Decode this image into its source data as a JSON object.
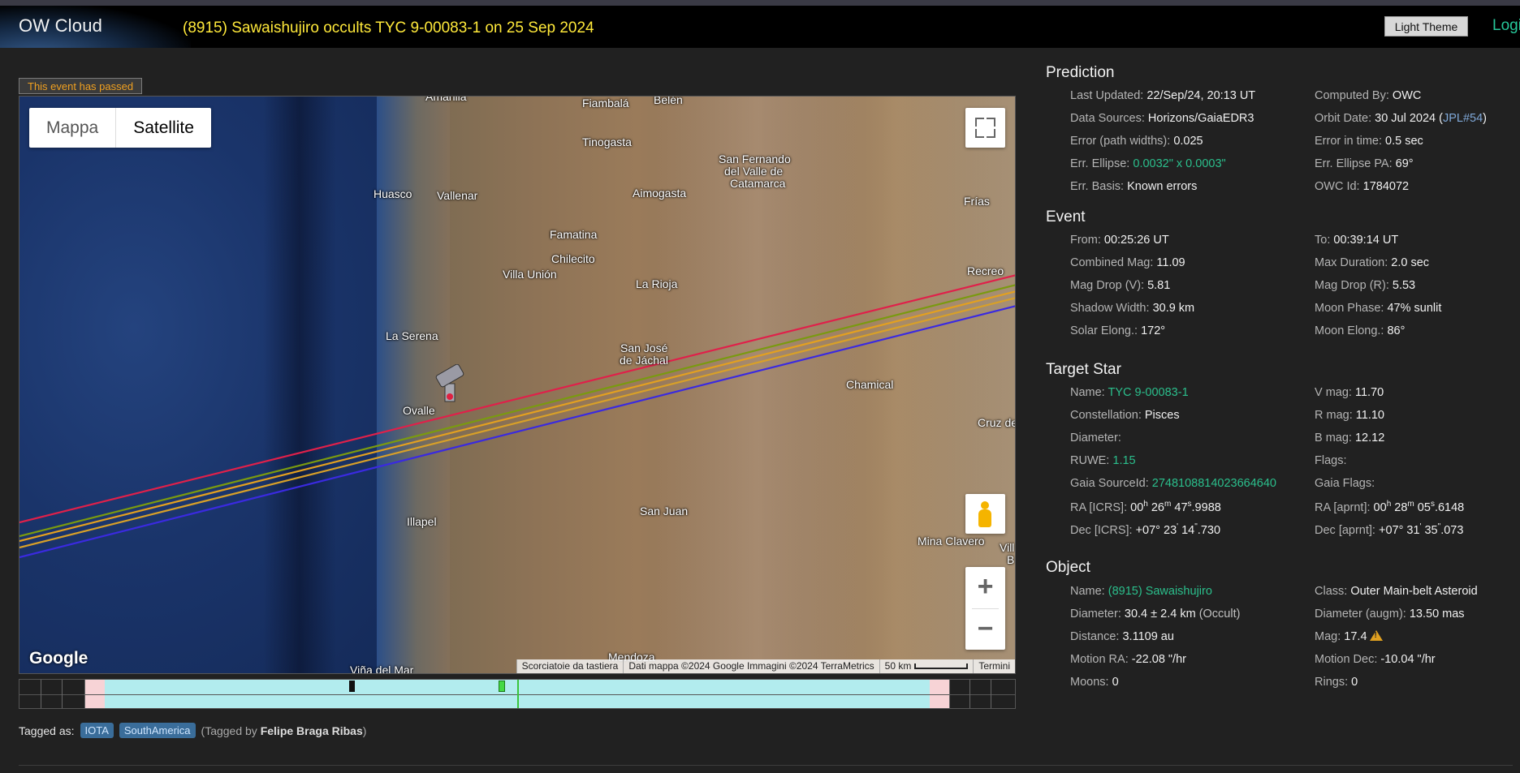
{
  "header": {
    "logo": "OW Cloud",
    "title": "(8915) Sawaishujiro occults TYC 9-00083-1 on 25 Sep 2024",
    "theme_button": "Light Theme",
    "login": "Logi"
  },
  "status_badge": "This event has passed",
  "map": {
    "maptype": [
      "Mappa",
      "Satellite"
    ],
    "places": [
      "Amarilla",
      "Fiambalá",
      "Belén",
      "Tinogasta",
      "San Fernando",
      "del Valle de",
      "Catamarca",
      "Huasco",
      "Vallenar",
      "Aimogasta",
      "Frías",
      "Famatina",
      "Chilecito",
      "Villa Unión",
      "La Rioja",
      "Recreo",
      "La Serena",
      "San José",
      "de Jáchal",
      "Chamical",
      "Ovalle",
      "Cruz de",
      "Illapel",
      "San Juan",
      "Mina Clavero",
      "Vill",
      "B",
      "Mendoza",
      "Viña del Mar"
    ],
    "google": "Google",
    "attribution": {
      "shortcuts": "Scorciatoie da tastiera",
      "data": "Dati mappa ©2024 Google Immagini ©2024 TerraMetrics",
      "scale": "50 km",
      "terms": "Termini"
    },
    "path_colors": [
      "#e0204a",
      "#7a9a10",
      "#e3a020",
      "#d8a028",
      "#3a2ae0"
    ]
  },
  "tags": {
    "label": "Tagged as:",
    "items": [
      "IOTA",
      "SouthAmerica"
    ],
    "tagged_by_prefix": "(Tagged by ",
    "tagged_by_name": "Felipe Braga Ribas",
    "tagged_by_suffix": ")"
  },
  "prediction": {
    "title": "Prediction",
    "last_updated_label": "Last Updated:",
    "last_updated": "22/Sep/24, 20:13 UT",
    "computed_by_label": "Computed By:",
    "computed_by": "OWC",
    "data_sources_label": "Data Sources:",
    "data_sources": "Horizons/GaiaEDR3",
    "orbit_date_label": "Orbit Date:",
    "orbit_date": "30 Jul 2024 (",
    "orbit_ref": "JPL#54",
    "orbit_close": ")",
    "error_path_label": "Error (path widths):",
    "error_path": "0.025",
    "error_time_label": "Error in time:",
    "error_time": "0.5 sec",
    "err_ellipse_label": "Err. Ellipse:",
    "err_ellipse": "0.0032\" x 0.0003\"",
    "err_ellipse_pa_label": "Err. Ellipse PA:",
    "err_ellipse_pa": "69°",
    "err_basis_label": "Err. Basis:",
    "err_basis": "Known errors",
    "owc_id_label": "OWC Id:",
    "owc_id": "1784072"
  },
  "event": {
    "title": "Event",
    "from_label": "From:",
    "from": "00:25:26 UT",
    "to_label": "To:",
    "to": "00:39:14 UT",
    "combined_mag_label": "Combined Mag:",
    "combined_mag": "11.09",
    "max_duration_label": "Max Duration:",
    "max_duration": "2.0 sec",
    "mag_drop_v_label": "Mag Drop (V):",
    "mag_drop_v": "5.81",
    "mag_drop_r_label": "Mag Drop (R):",
    "mag_drop_r": "5.53",
    "shadow_width_label": "Shadow Width:",
    "shadow_width": "30.9 km",
    "moon_phase_label": "Moon Phase:",
    "moon_phase": "47% sunlit",
    "solar_elong_label": "Solar Elong.:",
    "solar_elong": "172°",
    "moon_elong_label": "Moon Elong.:",
    "moon_elong": "86°"
  },
  "target_star": {
    "title": "Target Star",
    "name_label": "Name:",
    "name": "TYC 9-00083-1",
    "vmag_label": "V mag:",
    "vmag": "11.70",
    "constellation_label": "Constellation:",
    "constellation": "Pisces",
    "rmag_label": "R mag:",
    "rmag": "11.10",
    "diameter_label": "Diameter:",
    "bmag_label": "B mag:",
    "bmag": "12.12",
    "ruwe_label": "RUWE:",
    "ruwe": "1.15",
    "flags_label": "Flags:",
    "gaia_source_label": "Gaia SourceId:",
    "gaia_source": "2748108814023664640",
    "gaia_flags_label": "Gaia Flags:",
    "ra_icrs_label": "RA [ICRS]:",
    "ra_icrs": [
      "00",
      "h",
      " 26",
      "m",
      " 47",
      "s",
      ".9988"
    ],
    "ra_aprnt_label": "RA [aprnt]:",
    "ra_aprnt": [
      "00",
      "h",
      " 28",
      "m",
      " 05",
      "s",
      ".6148"
    ],
    "dec_icrs_label": "Dec [ICRS]:",
    "dec_icrs": [
      "+07° 23",
      "'",
      " 14",
      "\"",
      ".730"
    ],
    "dec_aprnt_label": "Dec [aprnt]:",
    "dec_aprnt": [
      "+07° 31",
      "'",
      " 35",
      "\"",
      ".073"
    ]
  },
  "object": {
    "title": "Object",
    "name_label": "Name:",
    "name": "(8915) Sawaishujiro",
    "class_label": "Class:",
    "class": "Outer Main-belt Asteroid",
    "diameter_label": "Diameter:",
    "diameter": "30.4 ± 2.4 km",
    "diameter_src": "(Occult)",
    "diameter_augm_label": "Diameter (augm):",
    "diameter_augm": "13.50 mas",
    "distance_label": "Distance:",
    "distance": "3.1109 au",
    "mag_label": "Mag:",
    "mag": "17.4",
    "motion_ra_label": "Motion RA:",
    "motion_ra": "-22.08 \"/hr",
    "motion_dec_label": "Motion Dec:",
    "motion_dec": "-10.04 \"/hr",
    "moons_label": "Moons:",
    "moons": "0",
    "rings_label": "Rings:",
    "rings": "0"
  }
}
